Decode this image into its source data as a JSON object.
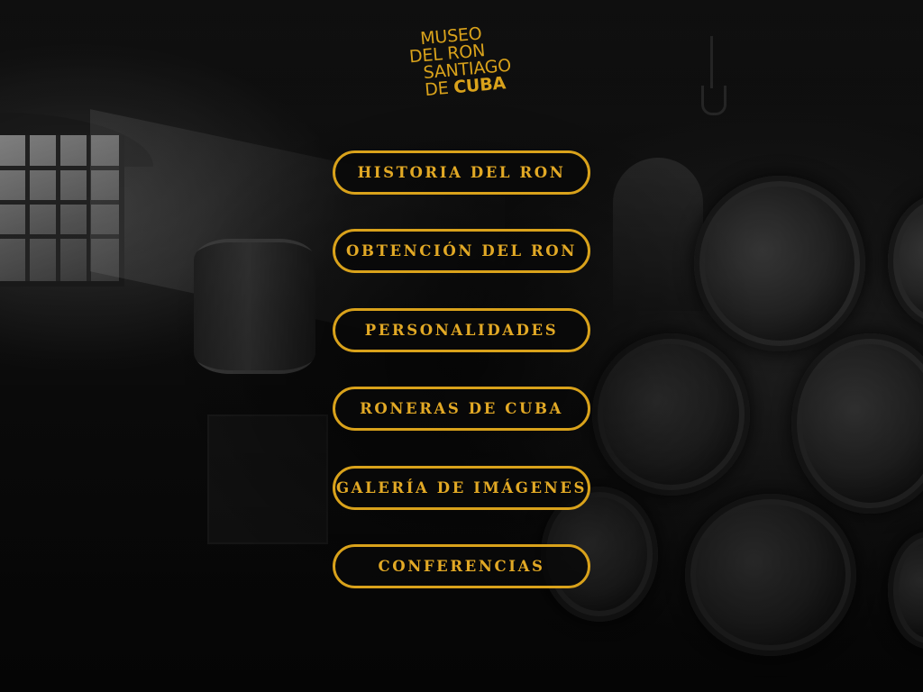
{
  "logo": {
    "line1": "MUSEO",
    "line2": "DEL RON",
    "line3": "SANTIAGO",
    "line4_prefix": "DE",
    "line4_bold": "CUBA"
  },
  "menu": {
    "items": [
      {
        "label": "HISTORIA DEL RON"
      },
      {
        "label": "OBTENCIÓN DEL RON"
      },
      {
        "label": "PERSONALIDADES"
      },
      {
        "label": "RONERAS DE CUBA"
      },
      {
        "label": "GALERÍA DE IMÁGENES"
      },
      {
        "label": "CONFERENCIAS"
      }
    ]
  },
  "colors": {
    "accent": "#d9a21b",
    "background": "#0b0b0b"
  }
}
